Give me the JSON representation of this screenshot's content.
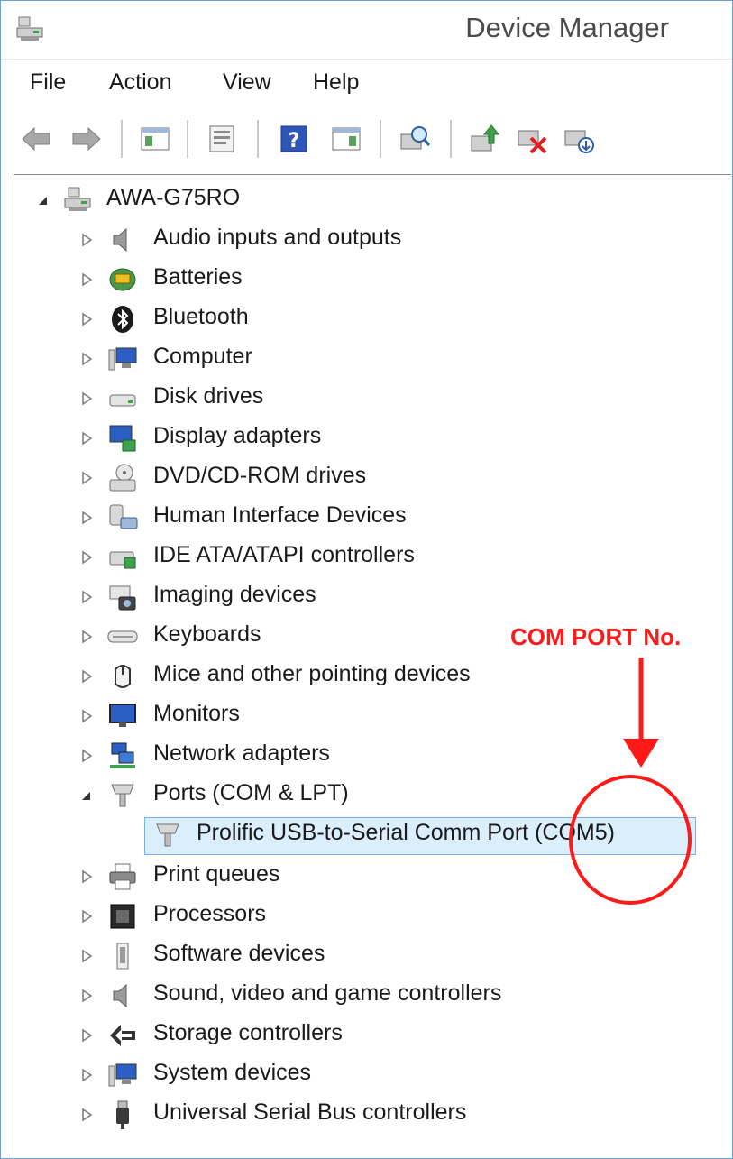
{
  "window": {
    "title": "Device Manager"
  },
  "menu": {
    "items": [
      "File",
      "Action",
      "View",
      "Help"
    ]
  },
  "toolbar": {
    "buttons": [
      "back-icon",
      "forward-icon",
      "show-hide-console-tree-icon",
      "properties-icon",
      "help-icon",
      "show-hide-action-pane-icon",
      "scan-hardware-changes-icon",
      "update-driver-icon",
      "uninstall-device-icon",
      "rollback-driver-icon"
    ]
  },
  "tree": {
    "root": {
      "label": "AWA-G75RO",
      "icon": "computer-network-icon"
    },
    "categories": [
      {
        "label": "Audio inputs and outputs",
        "icon": "speaker-icon"
      },
      {
        "label": "Batteries",
        "icon": "battery-icon"
      },
      {
        "label": "Bluetooth",
        "icon": "bluetooth-icon"
      },
      {
        "label": "Computer",
        "icon": "monitor-icon"
      },
      {
        "label": "Disk drives",
        "icon": "disk-drive-icon"
      },
      {
        "label": "Display adapters",
        "icon": "display-adapter-icon"
      },
      {
        "label": "DVD/CD-ROM drives",
        "icon": "dvd-drive-icon"
      },
      {
        "label": "Human Interface Devices",
        "icon": "hid-icon"
      },
      {
        "label": "IDE ATA/ATAPI controllers",
        "icon": "ide-controller-icon"
      },
      {
        "label": "Imaging devices",
        "icon": "camera-icon"
      },
      {
        "label": "Keyboards",
        "icon": "keyboard-icon"
      },
      {
        "label": "Mice and other pointing devices",
        "icon": "mouse-icon"
      },
      {
        "label": "Monitors",
        "icon": "monitor-icon"
      },
      {
        "label": "Network adapters",
        "icon": "network-adapter-icon"
      },
      {
        "label": "Ports (COM & LPT)",
        "icon": "port-icon",
        "expanded": true,
        "children": [
          {
            "label": "Prolific USB-to-Serial Comm Port (COM5)",
            "icon": "port-icon",
            "selected": true
          }
        ]
      },
      {
        "label": "Print queues",
        "icon": "printer-icon"
      },
      {
        "label": "Processors",
        "icon": "processor-icon"
      },
      {
        "label": "Software devices",
        "icon": "software-device-icon"
      },
      {
        "label": "Sound, video and game controllers",
        "icon": "speaker-icon"
      },
      {
        "label": "Storage controllers",
        "icon": "storage-controller-icon"
      },
      {
        "label": "System devices",
        "icon": "monitor-icon"
      },
      {
        "label": "Universal Serial Bus controllers",
        "icon": "usb-icon"
      }
    ]
  },
  "annotation": {
    "text": "COM PORT No.",
    "color": "#ff1a1a"
  },
  "colors": {
    "accent_border": "#6b9fd6",
    "selection_fill": "#dbeefc",
    "selection_border": "#7ab2e6"
  }
}
